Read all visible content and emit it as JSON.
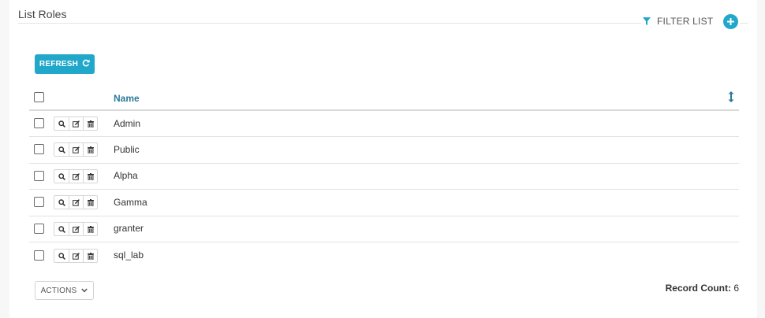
{
  "page": {
    "title": "List Roles"
  },
  "toolbar": {
    "filter_label": "FILTER LIST",
    "add_icon": "plus-icon",
    "refresh_label": "REFRESH",
    "refresh_icon": "refresh-icon"
  },
  "table": {
    "columns": [
      "Name"
    ],
    "rows": [
      {
        "name": "Admin"
      },
      {
        "name": "Public"
      },
      {
        "name": "Alpha"
      },
      {
        "name": "Gamma"
      },
      {
        "name": "granter"
      },
      {
        "name": "sql_lab"
      }
    ],
    "row_action_icons": [
      "search-icon",
      "edit-icon",
      "trash-icon"
    ]
  },
  "footer": {
    "actions_label": "ACTIONS",
    "record_count_label": "Record Count:",
    "record_count_value": "6"
  },
  "colors": {
    "accent": "#20a7c9",
    "header_link": "#2b7a98"
  }
}
